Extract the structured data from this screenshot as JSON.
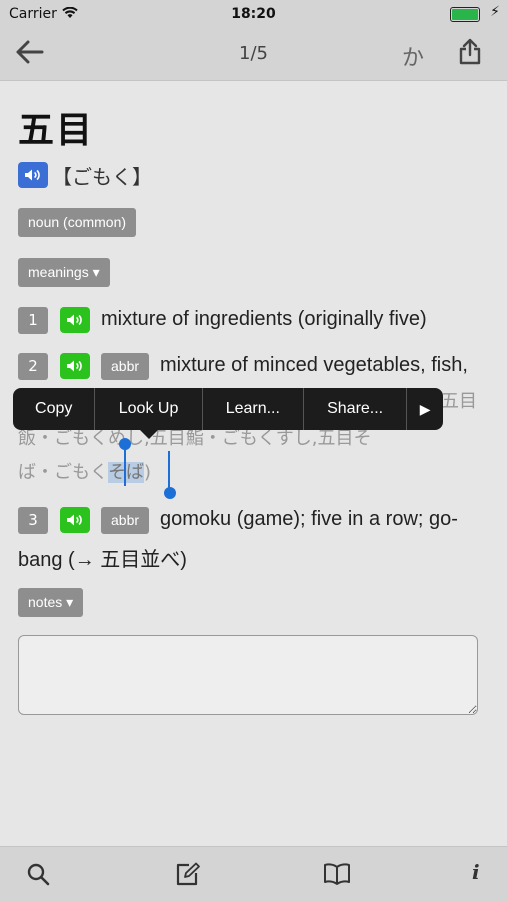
{
  "status": {
    "carrier": "Carrier",
    "time": "18:20",
    "battery_level": 1.0
  },
  "nav": {
    "counter": "1/5",
    "kana_button": "か"
  },
  "entry": {
    "headword": "五目",
    "reading": "【ごもく】",
    "pos_tag": "noun (common)",
    "meanings_toggle": "meanings ▾",
    "notes_toggle": "notes ▾",
    "senses": [
      {
        "number": "1",
        "text": "mixture of ingredients (originally five)"
      },
      {
        "number": "2",
        "badge": "abbr",
        "text": "mixture of minced vegetables, fish,",
        "example_line1_tail": "五目",
        "example_line2": "飯・ごもくめし,五目鮨・ごもくすし,五目そ",
        "example_line3_pre": "ば・ごもく",
        "example_line3_selected": "そば",
        "example_line3_post": ")"
      },
      {
        "number": "3",
        "badge": "abbr",
        "text_line1": "gomoku (game); five in a row; go-",
        "text_line2": "bang (→ 五目並べ)"
      }
    ]
  },
  "popup_menu": {
    "items": [
      "Copy",
      "Look Up",
      "Learn...",
      "Share..."
    ],
    "more": "▶"
  },
  "notes_value": "",
  "colors": {
    "speaker_blue": "#3b6fd6",
    "speaker_green": "#2cc21e",
    "tag_gray": "#8e8e8e",
    "selection": "#b8cce4",
    "handle": "#1c6fd7"
  }
}
